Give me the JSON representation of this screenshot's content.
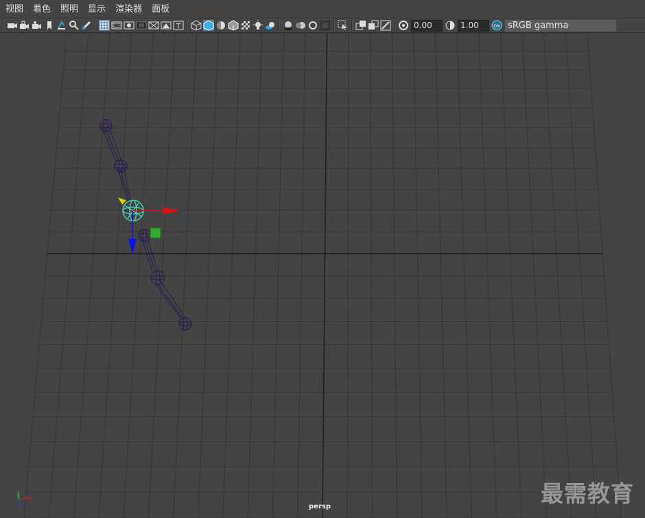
{
  "menu": {
    "items": [
      {
        "label": "视图"
      },
      {
        "label": "着色"
      },
      {
        "label": "照明"
      },
      {
        "label": "显示"
      },
      {
        "label": "渲染器"
      },
      {
        "label": "面板"
      }
    ]
  },
  "toolbar": {
    "exposure_value": "0.00",
    "gamma_value": "1.00",
    "color_space_label": "sRGB gamma"
  },
  "viewport": {
    "camera_label": "persp",
    "watermark": "最需教育"
  },
  "colors": {
    "background": "#444444",
    "grid": "#363636",
    "grid_axis": "#1f1f1f",
    "joint": "#2a1a55",
    "selected_joint": "#4fd9c4",
    "axis_x": "#e01010",
    "axis_y": "#1010e0",
    "axis_z_handle": "#e8d000",
    "plane_handle": "#33aa33"
  }
}
